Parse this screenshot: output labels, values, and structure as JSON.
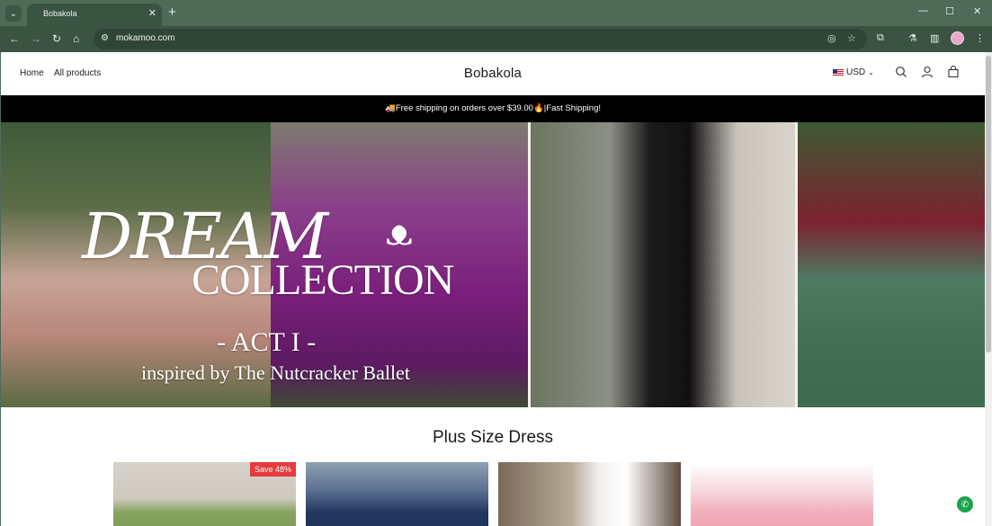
{
  "browser": {
    "tab_title": "Bobakola",
    "url": "mokamoo.com",
    "tab_close_glyph": "✕",
    "new_tab_glyph": "+",
    "minimize_glyph": "—",
    "maximize_glyph": "☐",
    "close_glyph": "✕",
    "back_glyph": "←",
    "forward_glyph": "→",
    "reload_glyph": "↻",
    "home_glyph": "⌂",
    "menu_glyph": "⋮"
  },
  "header": {
    "nav": [
      {
        "label": "Home"
      },
      {
        "label": "All products"
      }
    ],
    "brand": "Bobakola",
    "currency": "USD"
  },
  "announcement": "🚚Free shipping on orders over $39.00🔥|Fast Shipping!",
  "hero": {
    "line1": "DREAM",
    "line2": "COLLECTION",
    "act": "- ACT I -",
    "subtitle": "inspired by The Nutcracker Ballet"
  },
  "section": {
    "title": "Plus Size Dress"
  },
  "products": [
    {
      "badge": "Save 48%"
    },
    {
      "badge": ""
    },
    {
      "badge": ""
    },
    {
      "badge": ""
    }
  ],
  "icons": {
    "search": "search-icon",
    "account": "account-icon",
    "cart": "cart-icon",
    "chat": "chat-icon"
  }
}
